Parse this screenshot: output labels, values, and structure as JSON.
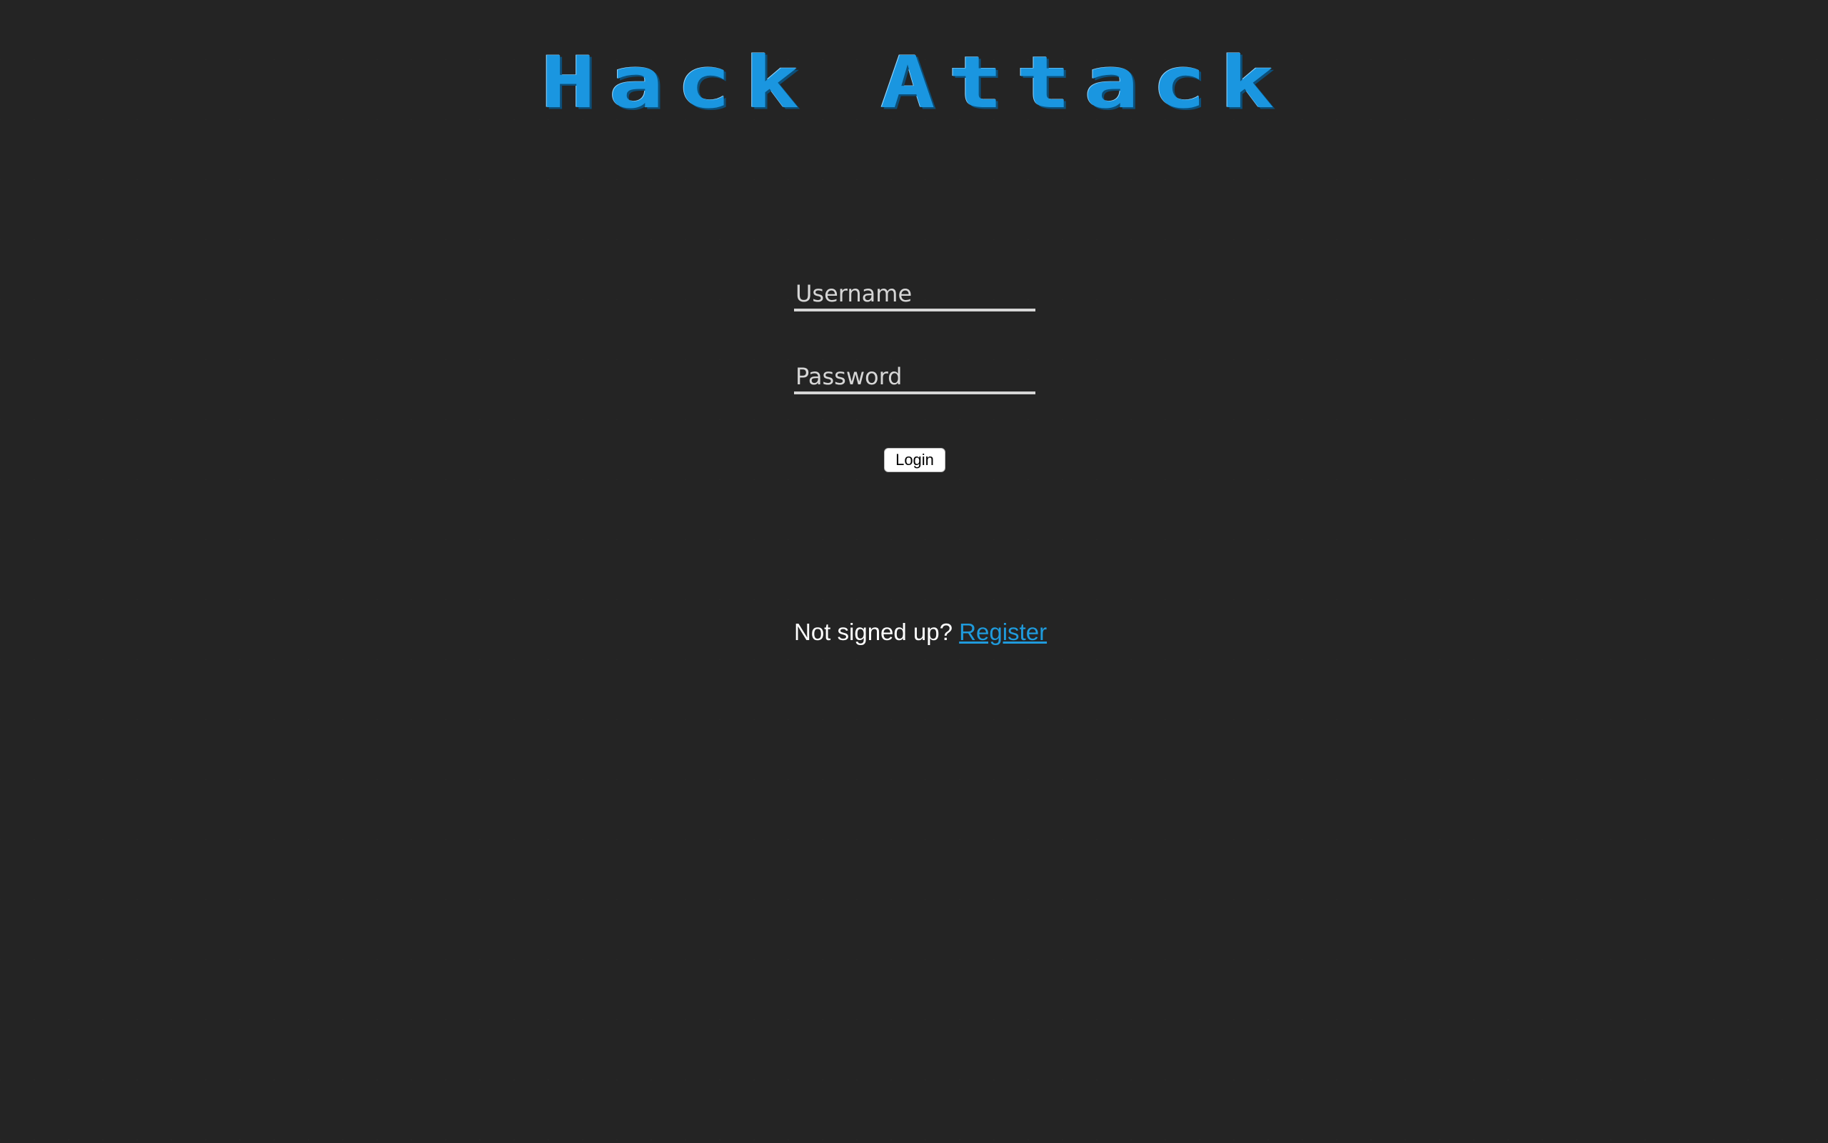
{
  "header": {
    "logo_text": "Hack Attack"
  },
  "login_form": {
    "username_placeholder": "Username",
    "password_placeholder": "Password",
    "login_label": "Login"
  },
  "register": {
    "prompt": "Not signed up?",
    "link_label": "Register"
  },
  "colors": {
    "background": "#242424",
    "logo": "#1a96e0",
    "link": "#1f9bdc"
  }
}
